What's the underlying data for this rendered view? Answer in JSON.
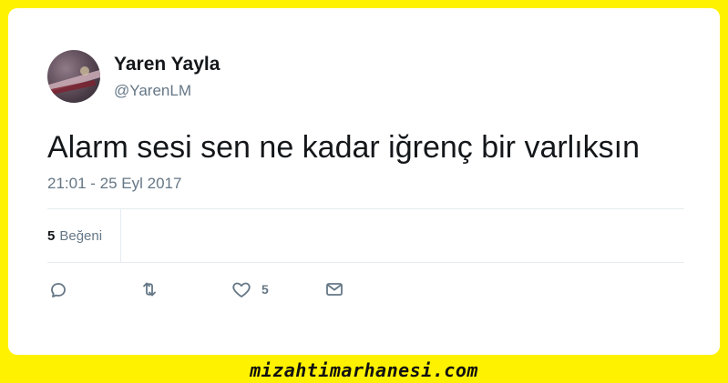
{
  "tweet": {
    "author": {
      "name": "Yaren Yayla",
      "handle": "@YarenLM"
    },
    "text": "Alarm sesi sen ne kadar iğrenç bir varlıksın",
    "timestamp": "21:01 - 25 Eyl 2017",
    "stats": {
      "likes_count": "5",
      "likes_label": "Beğeni"
    },
    "actions": {
      "reply_icon": "reply-icon",
      "retweet_icon": "retweet-icon",
      "like_icon": "heart-icon",
      "like_count": "5",
      "message_icon": "envelope-icon"
    }
  },
  "footer": {
    "watermark": "mizahtimarhanesi.com"
  },
  "colors": {
    "background": "#fff200",
    "card": "#ffffff",
    "text_primary": "#14171a",
    "text_secondary": "#657786",
    "divider": "#e6ecf0"
  }
}
